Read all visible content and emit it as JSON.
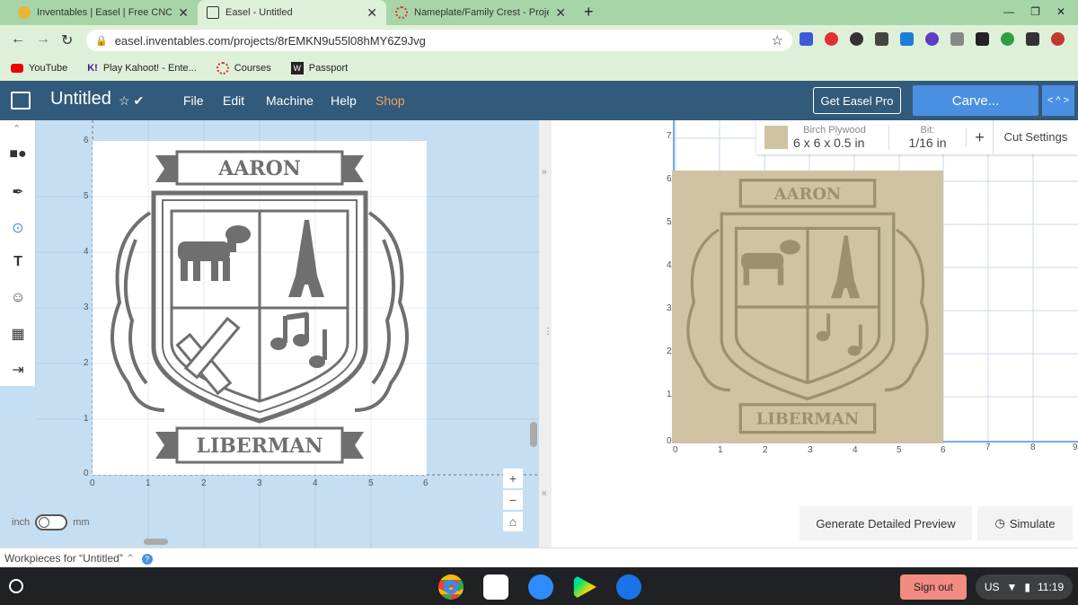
{
  "tabs": [
    {
      "title": "Inventables | Easel | Free CNC Software"
    },
    {
      "title": "Easel - Untitled"
    },
    {
      "title": "Nameplate/Family Crest - Project"
    }
  ],
  "address": {
    "url": "easel.inventables.com/projects/8rEMKN9u55l08hMY6Z9Jvg"
  },
  "bookmarks": [
    "YouTube",
    "Play Kahoot! - Ente...",
    "Courses",
    "Passport"
  ],
  "easel": {
    "project_title": "Untitled",
    "menu": [
      "File",
      "Edit",
      "Machine",
      "Help",
      "Shop"
    ],
    "get_pro": "Get Easel Pro",
    "carve": "Carve..."
  },
  "design": {
    "crest_top": "AARON",
    "crest_bottom": "LIBERMAN",
    "x_ticks": [
      "0",
      "1",
      "2",
      "3",
      "4",
      "5",
      "6"
    ],
    "y_ticks": [
      "6",
      "5",
      "4",
      "3",
      "2",
      "1",
      "0"
    ],
    "unit_left": "inch",
    "unit_right": "mm"
  },
  "preview": {
    "material_name": "Birch Plywood",
    "material_size": "6 x 6 x 0.5 in",
    "bit_label": "Bit:",
    "bit_value": "1/16 in",
    "cut_settings": "Cut Settings",
    "x_ticks": [
      "0",
      "1",
      "2",
      "3",
      "4",
      "5",
      "6",
      "7",
      "8",
      "9"
    ],
    "y_ticks": [
      "7",
      "6",
      "5",
      "4",
      "3",
      "2",
      "1",
      "0"
    ],
    "generate": "Generate Detailed Preview",
    "simulate": "Simulate"
  },
  "workpieces": "Workpieces for “Untitled”",
  "shelf": {
    "sign_out": "Sign out",
    "locale": "US",
    "time": "11:19"
  },
  "colors": {
    "header": "#325a7a",
    "carve": "#4a90e2",
    "shop": "#f0a35a",
    "crest": "#6f6f6f",
    "wood": "#cfc3a3"
  }
}
